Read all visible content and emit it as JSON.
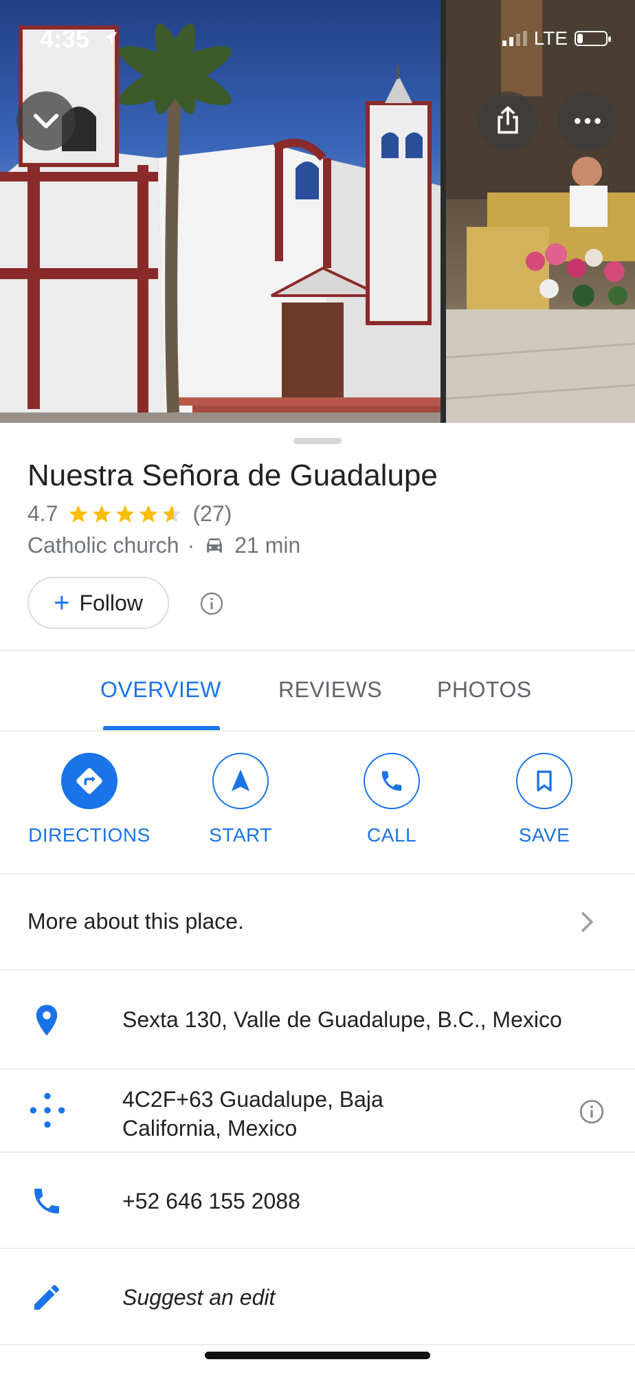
{
  "status_bar": {
    "time": "4:35",
    "network": "LTE"
  },
  "photos": {
    "collapse_icon": "chevron-down-icon",
    "share_icon": "share-icon",
    "more_icon": "more-horizontal-icon"
  },
  "place": {
    "name": "Nuestra Señora de Guadalupe",
    "rating": "4.7",
    "stars": 4.7,
    "review_count": "(27)",
    "category": "Catholic church",
    "separator": "·",
    "travel_time": "21 min",
    "follow_label": "Follow"
  },
  "tabs": [
    {
      "label": "OVERVIEW"
    },
    {
      "label": "REVIEWS"
    },
    {
      "label": "PHOTOS"
    }
  ],
  "actions": [
    {
      "label": "DIRECTIONS"
    },
    {
      "label": "START"
    },
    {
      "label": "CALL"
    },
    {
      "label": "SAVE"
    }
  ],
  "more_about": "More about this place.",
  "details": {
    "address": "Sexta 130, Valle de Guadalupe, B.C., Mexico",
    "plus_code_line1": "4C2F+63 Guadalupe, Baja",
    "plus_code_line2": "California, Mexico",
    "phone": "+52 646 155 2088",
    "suggest_edit": "Suggest an edit"
  },
  "colors": {
    "accent": "#1a73e8",
    "star": "#fbbc04",
    "secondary_text": "#70757a"
  }
}
